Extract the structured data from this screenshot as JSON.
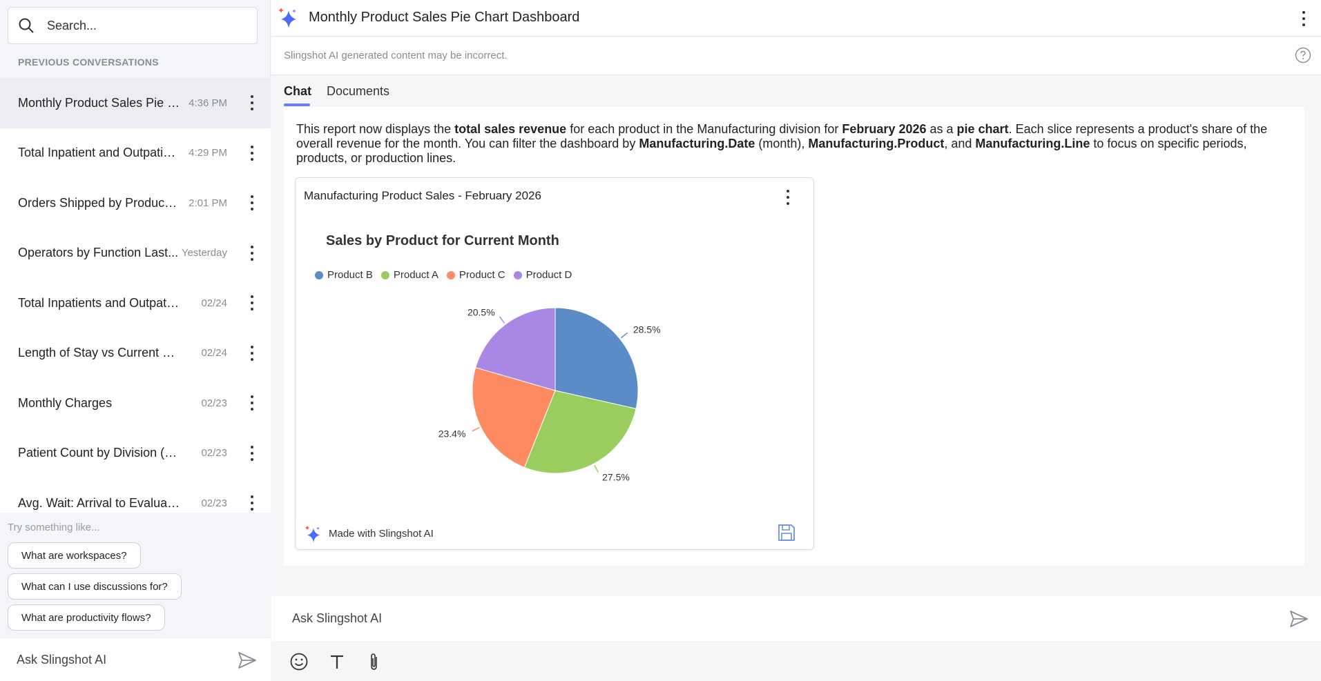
{
  "sidebar": {
    "search_placeholder": "Search...",
    "section_title": "PREVIOUS CONVERSATIONS",
    "conversations": [
      {
        "title": "Monthly Product Sales Pie C...",
        "time": "4:36 PM"
      },
      {
        "title": "Total Inpatient and Outpatie...",
        "time": "4:29 PM"
      },
      {
        "title": "Orders Shipped by Product V...",
        "time": "2:01 PM"
      },
      {
        "title": "Operators by Function Last...",
        "time": "Yesterday"
      },
      {
        "title": "Total Inpatients and Outpatien...",
        "time": "02/24"
      },
      {
        "title": "Length of Stay vs Current Pati...",
        "time": "02/24"
      },
      {
        "title": "Monthly Charges",
        "time": "02/23"
      },
      {
        "title": "Patient Count by Division (Last...",
        "time": "02/23"
      },
      {
        "title": "Avg. Wait: Arrival to Evaluation",
        "time": "02/23"
      }
    ],
    "try_label": "Try something like...",
    "suggestions": [
      "What are workspaces?",
      "What can I use discussions for?",
      "What are productivity flows?"
    ],
    "ask_placeholder": "Ask Slingshot AI"
  },
  "header": {
    "title": "Monthly Product Sales Pie Chart Dashboard",
    "disclaimer": "Slingshot AI generated content may be incorrect."
  },
  "tabs": {
    "chat": "Chat",
    "documents": "Documents"
  },
  "message": {
    "t1": "This report now displays the ",
    "b1": "total sales revenue",
    "t2": " for each product in the Manufacturing division for ",
    "b2": "February 2026",
    "t3": " as a ",
    "b3": "pie chart",
    "t4": ". Each slice represents a product's share of the overall revenue for the month. You can filter the dashboard by ",
    "b4": "Manufacturing.Date",
    "t5": " (month), ",
    "b5": "Manufacturing.Product",
    "t6": ", and ",
    "b6": "Manufacturing.Line",
    "t7": " to focus on specific periods, products, or production lines."
  },
  "card": {
    "title": "Manufacturing Product Sales - February 2026",
    "footer": "Made with Slingshot AI"
  },
  "chart_data": {
    "type": "pie",
    "title": "Sales by Product for Current Month",
    "legend_position": "top-left",
    "slices": [
      {
        "label": "Product B",
        "value": 28.5,
        "display": "28.5%",
        "color": "#5b8cc8"
      },
      {
        "label": "Product A",
        "value": 27.5,
        "display": "27.5%",
        "color": "#9bcd5e"
      },
      {
        "label": "Product C",
        "value": 23.4,
        "display": "23.4%",
        "color": "#fe8a62"
      },
      {
        "label": "Product D",
        "value": 20.5,
        "display": "20.5%",
        "color": "#a887e5"
      }
    ]
  },
  "composer": {
    "placeholder": "Ask Slingshot AI"
  }
}
